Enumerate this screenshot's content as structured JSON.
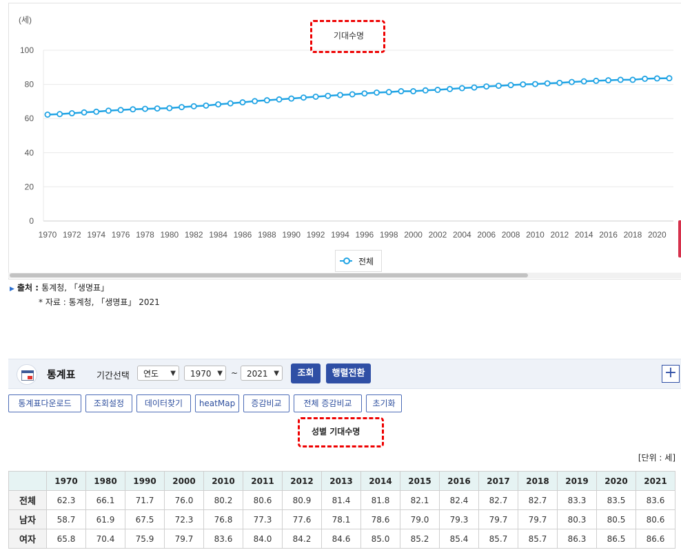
{
  "chart_data": {
    "type": "line",
    "title": "기대수명",
    "ylabel": "(세)",
    "ylim": [
      0,
      100
    ],
    "yticks": [
      0,
      20,
      40,
      60,
      80,
      100
    ],
    "grid": true,
    "legend_position": "bottom",
    "x": [
      1970,
      1971,
      1972,
      1973,
      1974,
      1975,
      1976,
      1977,
      1978,
      1979,
      1980,
      1981,
      1982,
      1983,
      1984,
      1985,
      1986,
      1987,
      1988,
      1989,
      1990,
      1991,
      1992,
      1993,
      1994,
      1995,
      1996,
      1997,
      1998,
      1999,
      2000,
      2001,
      2002,
      2003,
      2004,
      2005,
      2006,
      2007,
      2008,
      2009,
      2010,
      2011,
      2012,
      2013,
      2014,
      2015,
      2016,
      2017,
      2018,
      2019,
      2020,
      2021
    ],
    "xtick_labels": [
      "1970",
      "1972",
      "1974",
      "1976",
      "1978",
      "1980",
      "1982",
      "1984",
      "1986",
      "1988",
      "1990",
      "1992",
      "1994",
      "1996",
      "1998",
      "2000",
      "2002",
      "2004",
      "2006",
      "2008",
      "2010",
      "2012",
      "2014",
      "2016",
      "2018",
      "2020"
    ],
    "series": [
      {
        "name": "전체",
        "color": "#1fa3e4",
        "values": [
          62.3,
          62.6,
          63.1,
          63.6,
          64.0,
          64.6,
          65.0,
          65.4,
          65.7,
          65.9,
          66.1,
          66.7,
          67.2,
          67.6,
          68.3,
          68.9,
          69.5,
          70.2,
          70.7,
          71.2,
          71.7,
          72.3,
          72.8,
          73.3,
          73.8,
          74.2,
          74.7,
          75.2,
          75.5,
          76.0,
          76.0,
          76.5,
          76.8,
          77.3,
          77.8,
          78.2,
          78.8,
          79.2,
          79.6,
          80.0,
          80.2,
          80.6,
          80.9,
          81.4,
          81.8,
          82.1,
          82.4,
          82.7,
          82.7,
          83.3,
          83.5,
          83.6
        ]
      }
    ]
  },
  "source": {
    "label": "출처",
    "sep": " : ",
    "text": "통계청, 「생명표」",
    "note": "* 자료 : 통계청, 「생명표」 2021"
  },
  "stat_bar": {
    "icon": "table-sheet-icon",
    "title": "통계표",
    "period_label": "기간선택",
    "period_type": "연도",
    "from_year": "1970",
    "tilde": "~",
    "to_year": "2021",
    "query_label": "조회",
    "pivot_label": "행렬전환",
    "expand_label": "+"
  },
  "tools": [
    "통계표다운로드",
    "조회설정",
    "데이터찾기",
    "heatMap",
    "증감비교",
    "전체 증감비교",
    "초기화"
  ],
  "table": {
    "title": "성별 기대수명",
    "unit": "[단위 : 세]",
    "years": [
      "1970",
      "1980",
      "1990",
      "2000",
      "2010",
      "2011",
      "2012",
      "2013",
      "2014",
      "2015",
      "2016",
      "2017",
      "2018",
      "2019",
      "2020",
      "2021"
    ],
    "rows": [
      {
        "label": "전체",
        "values": [
          "62.3",
          "66.1",
          "71.7",
          "76.0",
          "80.2",
          "80.6",
          "80.9",
          "81.4",
          "81.8",
          "82.1",
          "82.4",
          "82.7",
          "82.7",
          "83.3",
          "83.5",
          "83.6"
        ]
      },
      {
        "label": "남자",
        "values": [
          "58.7",
          "61.9",
          "67.5",
          "72.3",
          "76.8",
          "77.3",
          "77.6",
          "78.1",
          "78.6",
          "79.0",
          "79.3",
          "79.7",
          "79.7",
          "80.3",
          "80.5",
          "80.6"
        ]
      },
      {
        "label": "여자",
        "values": [
          "65.8",
          "70.4",
          "75.9",
          "79.7",
          "83.6",
          "84.0",
          "84.2",
          "84.6",
          "85.0",
          "85.2",
          "85.4",
          "85.7",
          "85.7",
          "86.3",
          "86.5",
          "86.6"
        ]
      }
    ]
  }
}
